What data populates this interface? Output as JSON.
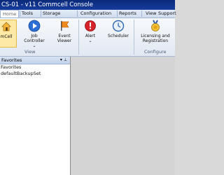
{
  "window": {
    "title": "CS-01 - v11 Commcell Console"
  },
  "menu": [
    "Home",
    "Tools",
    "Storage",
    "Configuration",
    "Reports",
    "View",
    "Support"
  ],
  "ribbon": {
    "commcell_label": "mCell",
    "job_controller_label": "Job Controller",
    "event_viewer_label": "Event Viewer",
    "alert_label": "Alert",
    "scheduler_label": "Scheduler",
    "licensing_label": "Licensing and Registration",
    "groups": {
      "view": "View",
      "configure": "Configure"
    }
  },
  "favorites_panel": {
    "title": "Favorites",
    "pin_glyph": "▾ ⊥",
    "items": [
      "Favorites",
      "defaultBackupSet"
    ]
  },
  "colors": {
    "title_bar": "#0a2a7a",
    "ribbon_bg": "#e6ecf4",
    "content_bg": "#d4d4d4"
  }
}
